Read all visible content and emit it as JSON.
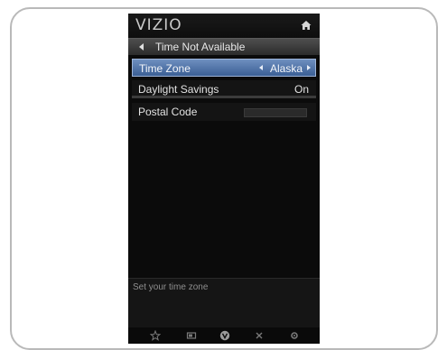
{
  "brand": {
    "logo": "VIZIO"
  },
  "header": {
    "back_title": "Time Not Available"
  },
  "menu": {
    "time_zone": {
      "label": "Time Zone",
      "value": "Alaska"
    },
    "daylight_savings": {
      "label": "Daylight Savings",
      "value": "On"
    },
    "postal_code": {
      "label": "Postal Code",
      "value": ""
    }
  },
  "help": {
    "text": "Set your time zone"
  },
  "bottom_bar": {
    "icons": [
      "star-icon",
      "input-icon",
      "vizio-v-icon",
      "close-icon",
      "gear-icon"
    ]
  },
  "colors": {
    "highlight": "#4a6ea6",
    "background": "#0b0b0b",
    "frame": "#b9b9b9"
  }
}
